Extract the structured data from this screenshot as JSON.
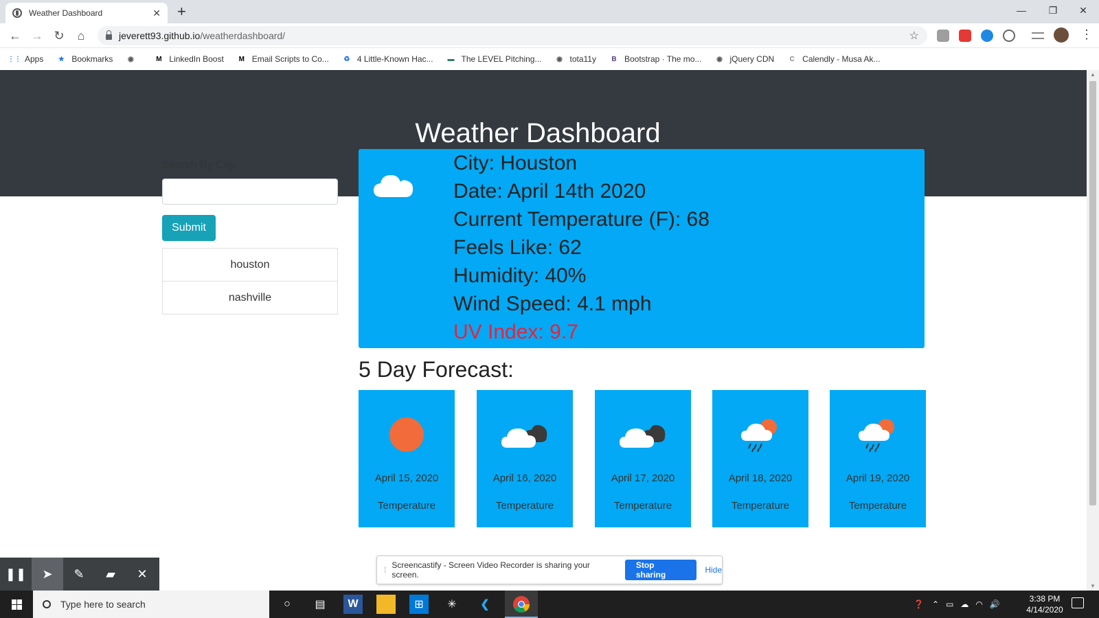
{
  "browser": {
    "tab_title": "Weather Dashboard",
    "url_host": "jeverett93.github.io",
    "url_path": "/weatherdashboard/",
    "bookmarks": [
      {
        "label": "Apps",
        "icon": "apps-grid-icon",
        "color": "#4285f4"
      },
      {
        "label": "Bookmarks",
        "icon": "star-icon",
        "color": "#1a73e8"
      },
      {
        "label": "",
        "icon": "globe-icon",
        "color": "#555555"
      },
      {
        "label": "LinkedIn Boost",
        "icon": "m-logo-icon",
        "color": "#000000"
      },
      {
        "label": "Email Scripts to Co...",
        "icon": "m-logo-icon",
        "color": "#000000"
      },
      {
        "label": "4 Little-Known Hac...",
        "icon": "recycle-icon",
        "color": "#1a73e8"
      },
      {
        "label": "The LEVEL Pitching...",
        "icon": "level-icon",
        "color": "#2e7d6b"
      },
      {
        "label": "tota11y",
        "icon": "globe-icon",
        "color": "#555555"
      },
      {
        "label": "Bootstrap · The mo...",
        "icon": "bootstrap-icon",
        "color": "#563d7c"
      },
      {
        "label": "jQuery CDN",
        "icon": "globe-icon",
        "color": "#555555"
      },
      {
        "label": "Calendly - Musa Ak...",
        "icon": "calendly-icon",
        "color": "#888888"
      }
    ]
  },
  "page": {
    "title": "Weather Dashboard",
    "search_label": "Search By City:",
    "search_value": "",
    "submit_label": "Submit",
    "history": [
      "houston",
      "nashville"
    ],
    "current": {
      "icon": "cloud-icon",
      "city": "City: Houston",
      "date": "Date: April 14th 2020",
      "temp": "Current Temperature (F): 68",
      "feels": "Feels Like: 62",
      "humidity": "Humidity: 40%",
      "wind": "Wind Speed: 4.1 mph",
      "uv": "UV Index: 9.7"
    },
    "forecast_title": "5 Day Forecast:",
    "forecast": [
      {
        "date": "April 15, 2020",
        "label": "Temperature",
        "icon": "sun-icon"
      },
      {
        "date": "April 16, 2020",
        "label": "Temperature",
        "icon": "dark-clouds-icon"
      },
      {
        "date": "April 17, 2020",
        "label": "Temperature",
        "icon": "dark-clouds-icon"
      },
      {
        "date": "April 18, 2020",
        "label": "Temperature",
        "icon": "rain-sun-icon"
      },
      {
        "date": "April 19, 2020",
        "label": "Temperature",
        "icon": "rain-sun-icon"
      }
    ]
  },
  "screencastify": {
    "message": "Screencastify - Screen Video Recorder is sharing your screen.",
    "stop_label": "Stop sharing",
    "hide_label": "Hide"
  },
  "taskbar": {
    "search_placeholder": "Type here to search",
    "time": "3:38 PM",
    "date": "4/14/2020"
  },
  "colors": {
    "header_bg": "#343a40",
    "card_bg": "#03a9f4",
    "submit_bg": "#17a2b8",
    "uv_text": "#ef1f3a"
  }
}
